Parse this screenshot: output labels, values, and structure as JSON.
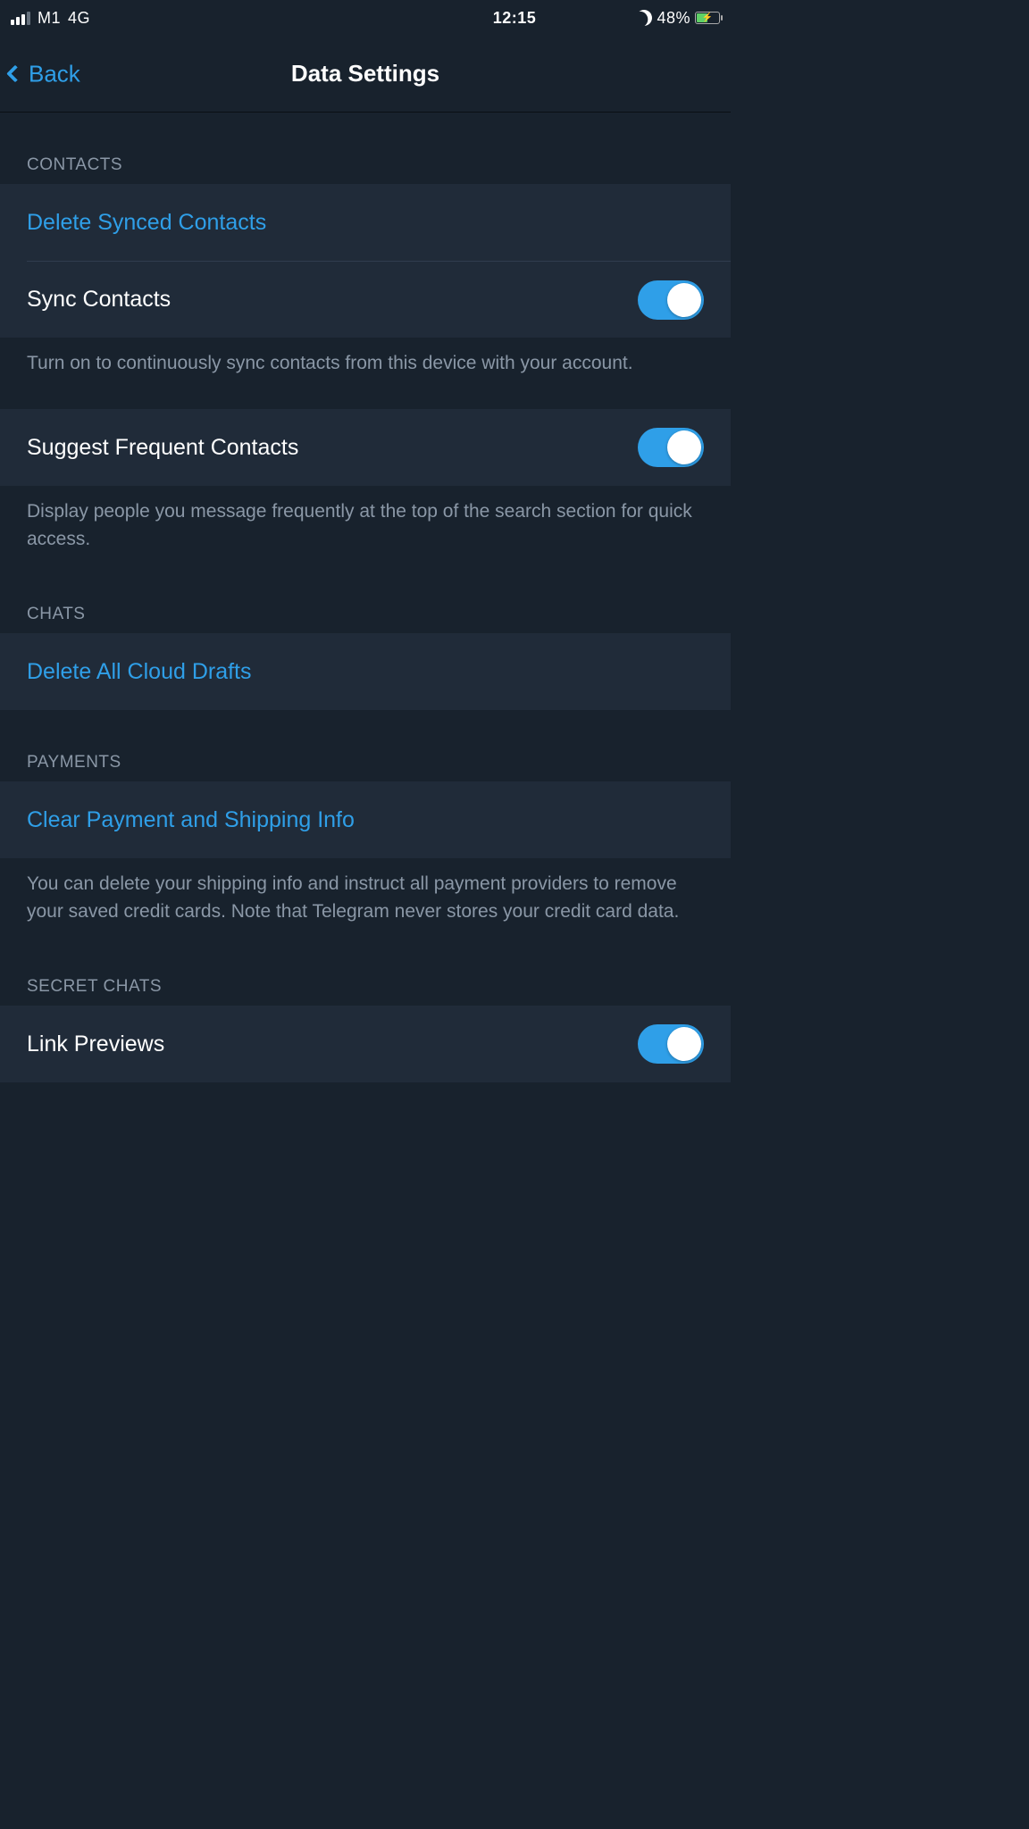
{
  "status": {
    "carrier": "M1",
    "network": "4G",
    "time": "12:15",
    "battery_percent": "48%"
  },
  "nav": {
    "back_label": "Back",
    "title": "Data Settings"
  },
  "sections": {
    "contacts": {
      "header": "CONTACTS",
      "delete_synced": "Delete Synced Contacts",
      "sync_contacts": "Sync Contacts",
      "sync_contacts_on": true,
      "sync_footer": "Turn on to continuously sync contacts from this device with your account.",
      "suggest_frequent": "Suggest Frequent Contacts",
      "suggest_frequent_on": true,
      "suggest_footer": "Display people you message frequently at the top of the search section for quick access."
    },
    "chats": {
      "header": "CHATS",
      "delete_drafts": "Delete All Cloud Drafts"
    },
    "payments": {
      "header": "PAYMENTS",
      "clear_payment": "Clear Payment and Shipping Info",
      "footer": "You can delete your shipping info and instruct all payment providers to remove your saved credit cards. Note that Telegram never stores your credit card data."
    },
    "secret_chats": {
      "header": "SECRET CHATS",
      "link_previews": "Link Previews",
      "link_previews_on": true
    }
  }
}
